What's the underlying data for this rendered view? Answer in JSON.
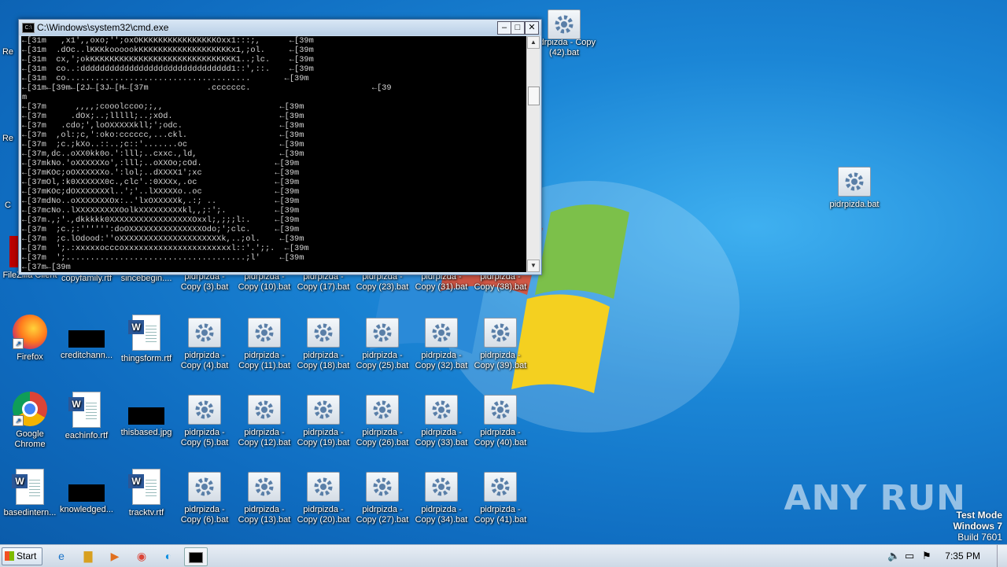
{
  "cmd_window": {
    "title": "C:\\Windows\\system32\\cmd.exe",
    "icon_label": "C:\\",
    "lines": [
      "←[31m   ,x1',,oxo;'';oxOKKKKKKKKKKKKKKKKOxx1:::;,      ←[39m",
      "←[31m  .dOc..lKKKkoooookKKKKKKKKKKKKKKKKKKKx1,;ol.     ←[39m",
      "←[31m  cx,';okKKKKKKKKKKKKKKKKKKKKKKKKKKKKKK1..;lc.    ←[39m",
      "←[31m  co..:ddddddddddddddddddddddddddddddd1::',::.    ←[39m",
      "←[31m  co......................................       ←[39m",
      "←[31m←[39m←[2J←[3J←[H←[37m            .ccccccc.                         ←[39",
      "m",
      "←[37m      ,,,,;cooolccoo;;,,                        ←[39m",
      "←[37m     .dOx;..;lllll;..;xOd.                      ←[39m",
      "←[37m   .cdo;',loOXXXXXkll;';odc.                    ←[39m",
      "←[37m  ,ol:;c,':oko:cccccc,...ckl.                   ←[39m",
      "←[37m  ;c.;kXo..::..;c::'.......oc                   ←[39m",
      "←[37m,dc..oXX0kk0o.':lll;..cxxc.,ld,                 ←[39m",
      "←[37mkNo.'oXXXXXXo',:lll;..oXXOo;cOd.               ←[39m",
      "←[37mKOc;oOXXXXXXo.':lol;..dXXXX1';xc               ←[39m",
      "←[37mOl,:k0XXXXXX0c.,clc'.:0XXXx,.oc                ←[39m",
      "←[37mKOc;dOXXXXXXXl..';'..lXXXXXo..oc               ←[39m",
      "←[37mdNo..oXXXXXXXOx:..'lxOXXXXXk,.:; ..            ←[39m",
      "←[37mcNo..lXXXXXXXXXOolkXXXXXXXXXkl,,;:';.          ←[39m",
      "←[37m.,;'.,dkkkkk0XXXXXXXXXXXXXXXXXOxxl;,;;;l:.     ←[39m",
      "←[37m  ;c.;:'''''':doOXXXXXXXXXXXXXXXOdo;';clc.     ←[39m",
      "←[37m  ;c.lOdood:''oXXXXXXXXXXXXXXXXXXXXXk,..;ol.    ←[39m",
      "←[37m  ';.:xxxxxocccoxxxxxxxxxxxxxxxxxxxxxxl::'.';;.  ←[39m",
      "←[37m  ';.....................................;l'    ←[39m",
      "←[37m←[39m"
    ]
  },
  "desktop": {
    "left_column": [
      {
        "label": "FileZilla Client",
        "icon": "filezilla-icon"
      },
      {
        "label": "Firefox",
        "icon": "firefox-icon"
      },
      {
        "label": "Google Chrome",
        "icon": "chrome-icon"
      },
      {
        "label": "basedintern...",
        "icon": "word-doc-icon"
      }
    ],
    "col2": [
      {
        "label": "copyfamily.rtf",
        "icon": "word-doc-icon"
      },
      {
        "label": "creditchann...",
        "icon": "redacted-icon"
      },
      {
        "label": "eachinfo.rtf",
        "icon": "word-doc-icon"
      },
      {
        "label": "knowledged...",
        "icon": "redacted-icon"
      }
    ],
    "col3": [
      {
        "label": "sincebegin....",
        "icon": "word-doc-icon"
      },
      {
        "label": "thingsform.rtf",
        "icon": "word-doc-icon"
      },
      {
        "label": "thisbased.jpg",
        "icon": "redacted-icon"
      },
      {
        "label": "tracktv.rtf",
        "icon": "word-doc-icon"
      }
    ],
    "bat_grid": [
      [
        "pidrpizda - Copy (3).bat",
        "pidrpizda - Copy (10).bat",
        "pidrpizda - Copy (17).bat",
        "pidrpizda - Copy (23).bat",
        "pidrpizda - Copy (31).bat",
        "pidrpizda - Copy (38).bat"
      ],
      [
        "pidrpizda - Copy (4).bat",
        "pidrpizda - Copy (11).bat",
        "pidrpizda - Copy (18).bat",
        "pidrpizda - Copy (25).bat",
        "pidrpizda - Copy (32).bat",
        "pidrpizda - Copy (39).bat"
      ],
      [
        "pidrpizda - Copy (5).bat",
        "pidrpizda - Copy (12).bat",
        "pidrpizda - Copy (19).bat",
        "pidrpizda - Copy (26).bat",
        "pidrpizda - Copy (33).bat",
        "pidrpizda - Copy (40).bat"
      ],
      [
        "pidrpizda - Copy (6).bat",
        "pidrpizda - Copy (13).bat",
        "pidrpizda - Copy (20).bat",
        "pidrpizda - Copy (27).bat",
        "pidrpizda - Copy (34).bat",
        "pidrpizda - Copy (41).bat"
      ]
    ],
    "top_right_icon": "pidrpizda - Copy (42).bat",
    "lone_icon": "pidrpizda.bat",
    "partial_left_labels": [
      "Re",
      "Re",
      "C"
    ]
  },
  "watermark": "ANY RUN",
  "test_mode": {
    "line1": "Test Mode",
    "line2": "Windows 7",
    "line3": "Build 7601"
  },
  "taskbar": {
    "start_label": "Start",
    "clock": "7:35 PM",
    "pinned": [
      "ie-icon",
      "explorer-icon",
      "media-player-icon",
      "chrome-icon",
      "edge-icon",
      "cmd-icon"
    ]
  }
}
